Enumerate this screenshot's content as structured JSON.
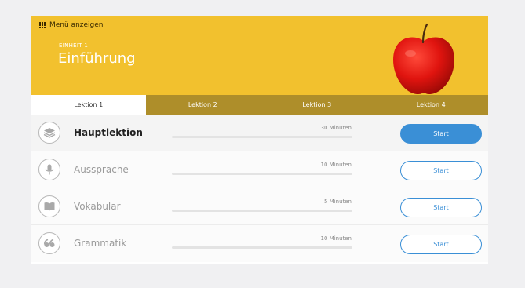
{
  "header": {
    "menu_label": "Menü anzeigen",
    "unit_label": "EINHEIT 1",
    "unit_title": "Einführung",
    "background_color": "#f2c12e",
    "illustration_icon": "apple-icon"
  },
  "tabs": [
    {
      "label": "Lektion 1",
      "active": true
    },
    {
      "label": "Lektion 2",
      "active": false
    },
    {
      "label": "Lektion 3",
      "active": false
    },
    {
      "label": "Lektion 4",
      "active": false
    }
  ],
  "lessons": [
    {
      "title": "Hauptlektion",
      "duration": "30 Minuten",
      "button": "Start",
      "icon": "layers-icon",
      "progress": 0
    },
    {
      "title": "Aussprache",
      "duration": "10 Minuten",
      "button": "Start",
      "icon": "microphone-icon",
      "progress": 0
    },
    {
      "title": "Vokabular",
      "duration": "5 Minuten",
      "button": "Start",
      "icon": "book-icon",
      "progress": 0
    },
    {
      "title": "Grammatik",
      "duration": "10 Minuten",
      "button": "Start",
      "icon": "quote-icon",
      "progress": 0
    }
  ],
  "colors": {
    "accent": "#3a8fd6",
    "tab_bar": "#ae8e2a"
  }
}
